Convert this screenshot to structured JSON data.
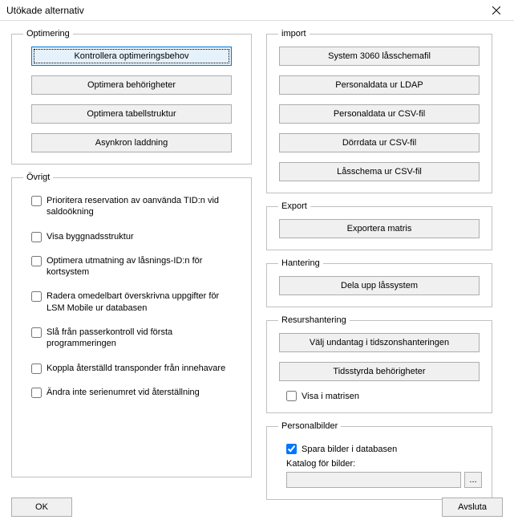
{
  "window": {
    "title": "Utökade alternativ"
  },
  "groups": {
    "optimering": {
      "legend": "Optimering",
      "buttons": [
        "Kontrollera optimeringsbehov",
        "Optimera behörigheter",
        "Optimera tabellstruktur",
        "Asynkron laddning"
      ]
    },
    "ovrigt": {
      "legend": "Övrigt",
      "checkboxes": [
        "Prioritera reservation av oanvända TID:n vid saldoökning",
        "Visa byggnadsstruktur",
        "Optimera utmatning av låsnings-ID:n för kortsystem",
        "Radera omedelbart överskrivna uppgifter för LSM Mobile ur databasen",
        "Slå från passerkontroll vid första programmeringen",
        "Koppla återställd transponder från innehavare",
        "Ändra inte serienumret vid återställning"
      ]
    },
    "import": {
      "legend": "import",
      "buttons": [
        "System 3060 låsschemafil",
        "Personaldata ur LDAP",
        "Personaldata ur CSV-fil",
        "Dörrdata ur CSV-fil",
        "Låsschema ur CSV-fil"
      ]
    },
    "export": {
      "legend": "Export",
      "button": "Exportera matris"
    },
    "hantering": {
      "legend": "Hantering",
      "button": "Dela upp låssystem"
    },
    "resurshantering": {
      "legend": "Resurshantering",
      "buttons": [
        "Välj undantag i tidszonshanteringen",
        "Tidsstyrda behörigheter"
      ],
      "checkbox": "Visa i matrisen"
    },
    "personalbilder": {
      "legend": "Personalbilder",
      "checkbox": "Spara bilder i databasen",
      "catalogLabel": "Katalog för bilder:",
      "catalogValue": "",
      "browseLabel": "..."
    }
  },
  "footer": {
    "ok": "OK",
    "avsluta": "Avsluta"
  }
}
